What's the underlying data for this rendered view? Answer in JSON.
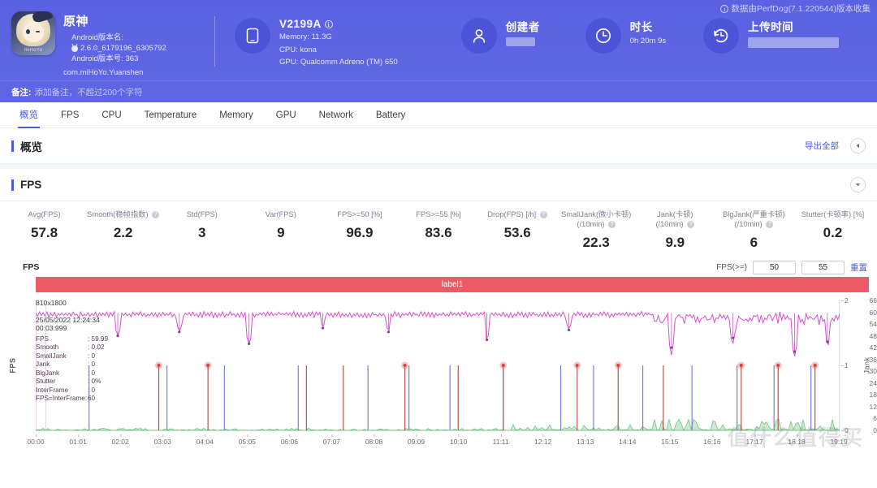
{
  "header": {
    "collect_note": "数据由PerfDog(7.1.220544)版本收集",
    "app": {
      "icon_brand": "miHoYo",
      "name": "原神",
      "version_name_label": "Android版本名:",
      "version_name": "2.6.0_6179196_6305792",
      "version_code": "Android版本号: 363",
      "package": "com.miHoYo.Yuanshen"
    },
    "device": {
      "name": "V2199A",
      "memory": "Memory: 11.3G",
      "cpu": "CPU: kona",
      "gpu": "GPU: Qualcomm Adreno (TM) 650"
    },
    "creator": {
      "label": "创建者",
      "value": ""
    },
    "duration": {
      "label": "时长",
      "value": "0h 20m 9s"
    },
    "upload": {
      "label": "上传时间",
      "value": ""
    }
  },
  "note": {
    "label": "备注:",
    "placeholder": "添加备注，不超过200个字符"
  },
  "tabs": [
    {
      "label": "概览",
      "active": true
    },
    {
      "label": "FPS",
      "active": false
    },
    {
      "label": "CPU",
      "active": false
    },
    {
      "label": "Temperature",
      "active": false
    },
    {
      "label": "Memory",
      "active": false
    },
    {
      "label": "GPU",
      "active": false
    },
    {
      "label": "Network",
      "active": false
    },
    {
      "label": "Battery",
      "active": false
    }
  ],
  "overview": {
    "title": "概览",
    "export_all": "导出全部"
  },
  "fps_section": {
    "title": "FPS"
  },
  "metrics": [
    {
      "label": "Avg(FPS)",
      "help": false,
      "value": "57.8"
    },
    {
      "label": "Smooth(稳帧指数)",
      "help": true,
      "value": "2.2"
    },
    {
      "label": "Std(FPS)",
      "help": false,
      "value": "3"
    },
    {
      "label": "Var(FPS)",
      "help": false,
      "value": "9"
    },
    {
      "label": "FPS>=50 [%]",
      "help": false,
      "value": "96.9"
    },
    {
      "label": "FPS>=55 [%]",
      "help": false,
      "value": "83.6"
    },
    {
      "label": "Drop(FPS) [/h]",
      "help": true,
      "value": "53.6"
    },
    {
      "label": "SmallJank(微小卡顿)",
      "label2": "(/10min)",
      "help": true,
      "value": "22.3"
    },
    {
      "label": "Jank(卡顿)",
      "label2": "(/10min)",
      "help": true,
      "value": "9.9"
    },
    {
      "label": "BigJank(严重卡顿)",
      "label2": "(/10min)",
      "help": true,
      "value": "6"
    },
    {
      "label": "Stutter(卡顿率) [%]",
      "help": false,
      "value": "0.2"
    }
  ],
  "chart_controls": {
    "axis_title": "FPS",
    "fps_ge_label": "FPS(>=)",
    "threshold1": "50",
    "threshold2": "55",
    "reset": "重置"
  },
  "tooltip": {
    "resolution": "810x1800",
    "datetime": "25/05/2022 12:24:34",
    "elapsed": "00:03:999",
    "rows": [
      {
        "k": "FPS",
        "v": ": 59.99"
      },
      {
        "k": "Smooth",
        "v": ": 0.02"
      },
      {
        "k": "SmallJank",
        "v": ": 0"
      },
      {
        "k": "Jank",
        "v": ": 0"
      },
      {
        "k": "BigJank",
        "v": ": 0"
      },
      {
        "k": "Stutter",
        "v": ": 0%"
      },
      {
        "k": "InterFrame",
        "v": ": 0"
      },
      {
        "k": "FPS=InterFrame:",
        "v": "60"
      }
    ]
  },
  "watermark": "值什么值得买",
  "chart_data": {
    "type": "line",
    "title": "FPS",
    "xlabel": "",
    "ylabel": "FPS",
    "y2label": "Jank",
    "ylim": [
      0,
      66
    ],
    "y2lim": [
      0,
      2
    ],
    "yticks": [
      0,
      6,
      12,
      18,
      24,
      30,
      36,
      42,
      48,
      54,
      60,
      66
    ],
    "y2ticks": [
      0,
      1,
      2
    ],
    "xticks": [
      "00:00",
      "01:01",
      "02:02",
      "03:03",
      "04:04",
      "05:05",
      "06:06",
      "07:07",
      "08:08",
      "09:09",
      "10:10",
      "11:11",
      "12:12",
      "13:13",
      "14:14",
      "15:15",
      "16:16",
      "17:17",
      "18:18",
      "19:19"
    ],
    "grid": false,
    "label_band": "label1",
    "series": [
      {
        "name": "FPS",
        "color": "#d94fd1",
        "type": "line",
        "baseline": 59.5,
        "dips": [
          {
            "x": 2.0,
            "y": 48
          },
          {
            "x": 3.5,
            "y": 50
          },
          {
            "x": 5.2,
            "y": 44
          },
          {
            "x": 7.0,
            "y": 52
          },
          {
            "x": 8.6,
            "y": 50
          },
          {
            "x": 11.0,
            "y": 46
          },
          {
            "x": 13.0,
            "y": 51
          },
          {
            "x": 15.5,
            "y": 42
          },
          {
            "x": 17.0,
            "y": 47
          },
          {
            "x": 18.5,
            "y": 40
          },
          {
            "x": 19.3,
            "y": 45
          }
        ]
      },
      {
        "name": "Jank",
        "color": "#7b7fd4",
        "type": "spike",
        "axis": "y2",
        "points": [
          {
            "x": 1.3,
            "y": 1
          },
          {
            "x": 3.2,
            "y": 1
          },
          {
            "x": 4.6,
            "y": 1
          },
          {
            "x": 6.4,
            "y": 1
          },
          {
            "x": 8.1,
            "y": 1
          },
          {
            "x": 9.1,
            "y": 1
          },
          {
            "x": 10.1,
            "y": 1
          },
          {
            "x": 11.4,
            "y": 1
          },
          {
            "x": 12.8,
            "y": 1
          },
          {
            "x": 13.6,
            "y": 1
          },
          {
            "x": 14.8,
            "y": 1
          },
          {
            "x": 16.0,
            "y": 1
          },
          {
            "x": 17.1,
            "y": 1
          },
          {
            "x": 18.0,
            "y": 1
          },
          {
            "x": 18.9,
            "y": 1
          }
        ]
      },
      {
        "name": "BigJank",
        "color": "#b2574f",
        "type": "spike-marker",
        "axis": "y2",
        "points": [
          {
            "x": 3.0,
            "y": 1,
            "marker": true
          },
          {
            "x": 4.2,
            "y": 1,
            "marker": true
          },
          {
            "x": 6.6,
            "y": 1,
            "marker": false
          },
          {
            "x": 7.5,
            "y": 1,
            "marker": false
          },
          {
            "x": 9.0,
            "y": 1,
            "marker": true
          },
          {
            "x": 10.3,
            "y": 1,
            "marker": false
          },
          {
            "x": 11.4,
            "y": 1,
            "marker": true
          },
          {
            "x": 13.2,
            "y": 1,
            "marker": true
          },
          {
            "x": 14.2,
            "y": 1,
            "marker": true
          },
          {
            "x": 15.3,
            "y": 1,
            "marker": false
          },
          {
            "x": 17.2,
            "y": 1,
            "marker": true
          },
          {
            "x": 18.1,
            "y": 1,
            "marker": true
          },
          {
            "x": 19.0,
            "y": 1,
            "marker": true
          }
        ]
      },
      {
        "name": "Stutter",
        "color": "#6bbf7b",
        "type": "area-noise",
        "axis": "y",
        "max": 8
      }
    ]
  }
}
